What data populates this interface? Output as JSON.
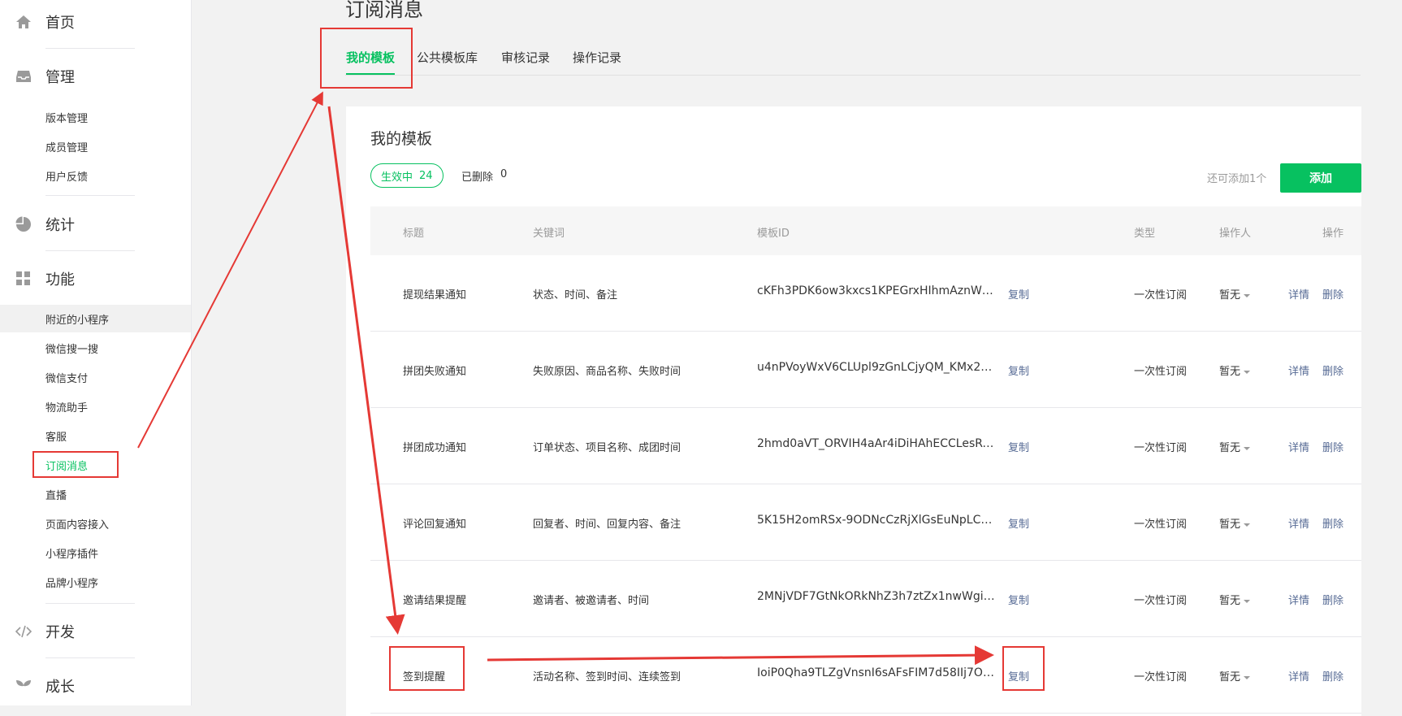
{
  "sidebar": {
    "sections": [
      {
        "label": "首页",
        "icon": "home-icon"
      },
      {
        "label": "管理",
        "icon": "inbox-icon",
        "items": [
          "版本管理",
          "成员管理",
          "用户反馈"
        ]
      },
      {
        "label": "统计",
        "icon": "pie-chart-icon"
      },
      {
        "label": "功能",
        "icon": "grid-icon",
        "items": [
          "附近的小程序",
          "微信搜一搜",
          "微信支付",
          "物流助手",
          "客服",
          "订阅消息",
          "直播",
          "页面内容接入",
          "小程序插件",
          "品牌小程序"
        ]
      },
      {
        "label": "开发",
        "icon": "code-icon"
      },
      {
        "label": "成长",
        "icon": "leaf-icon"
      }
    ],
    "hover_item": "附近的小程序",
    "active_item": "订阅消息"
  },
  "page_title": "订阅消息",
  "tabs": [
    {
      "label": "我的模板",
      "active": true
    },
    {
      "label": "公共模板库",
      "active": false
    },
    {
      "label": "审核记录",
      "active": false
    },
    {
      "label": "操作记录",
      "active": false
    }
  ],
  "card": {
    "title": "我的模板",
    "status_active_label": "生效中",
    "status_active_count": "24",
    "status_deleted_label": "已删除",
    "status_deleted_count": "0",
    "remaining_text": "还可添加1个",
    "add_button": "添加"
  },
  "table": {
    "headers": {
      "title": "标题",
      "keywords": "关键词",
      "template_id": "模板ID",
      "type": "类型",
      "operator": "操作人",
      "actions": "操作"
    },
    "copy_label": "复制",
    "detail_label": "详情",
    "delete_label": "删除",
    "rows": [
      {
        "title": "提现结果通知",
        "keywords": "状态、时间、备注",
        "template_id": "cKFh3PDK6ow3kxcs1KPEGrxHIhmAznW4u...",
        "type": "一次性订阅",
        "operator": "暂无"
      },
      {
        "title": "拼团失败通知",
        "keywords": "失败原因、商品名称、失败时间",
        "template_id": "u4nPVoyWxV6CLUpl9zGnLCjyQM_KMx2ky...",
        "type": "一次性订阅",
        "operator": "暂无"
      },
      {
        "title": "拼团成功通知",
        "keywords": "订单状态、项目名称、成团时间",
        "template_id": "2hmd0aVT_ORVIH4aAr4iDiHAhECCLesRea...",
        "type": "一次性订阅",
        "operator": "暂无"
      },
      {
        "title": "评论回复通知",
        "keywords": "回复者、时间、回复内容、备注",
        "template_id": "5K15H2omRSx-9ODNcCzRjXlGsEuNpLCgt...",
        "type": "一次性订阅",
        "operator": "暂无"
      },
      {
        "title": "邀请结果提醒",
        "keywords": "邀请者、被邀请者、时间",
        "template_id": "2MNjVDF7GtNkORkNhZ3h7ztZx1nwWgiR...",
        "type": "一次性订阅",
        "operator": "暂无"
      },
      {
        "title": "签到提醒",
        "keywords": "活动名称、签到时间、连续签到",
        "template_id": "IoiP0Qha9TLZgVnsnI6sAFsFIM7d58IIj7O3f...",
        "type": "一次性订阅",
        "operator": "暂无"
      }
    ]
  },
  "colors": {
    "accent": "#07c160",
    "link": "#576b95",
    "annotation": "#e53935"
  }
}
